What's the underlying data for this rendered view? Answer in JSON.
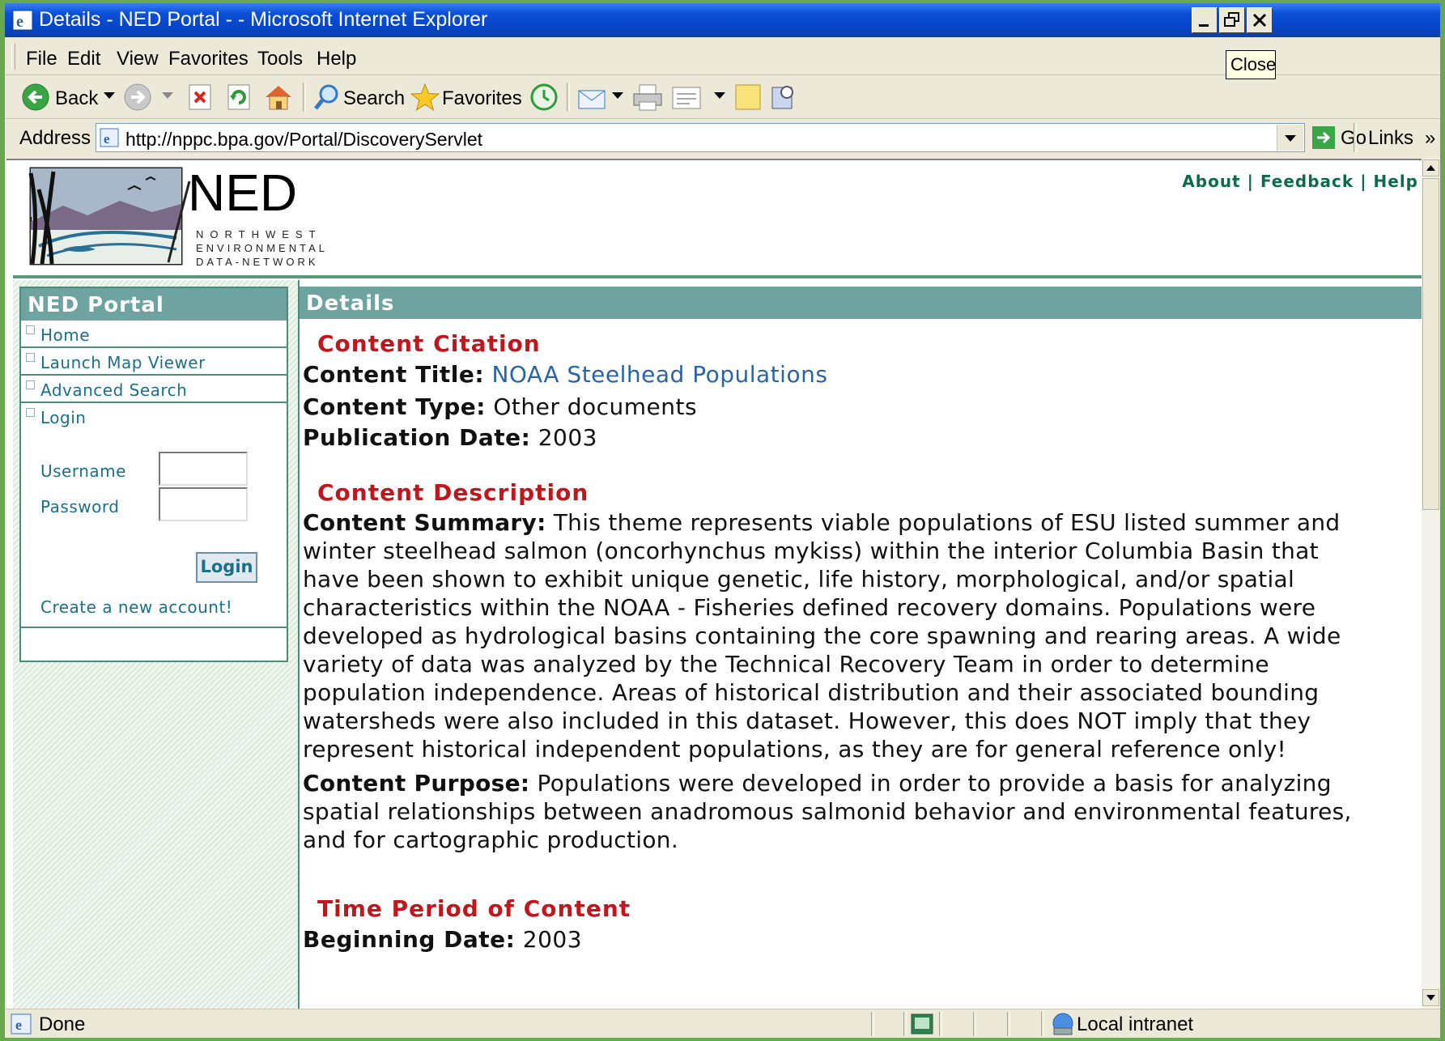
{
  "window": {
    "title": "Details - NED Portal - - Microsoft Internet Explorer",
    "tooltip": "Close"
  },
  "menu": [
    "File",
    "Edit",
    "View",
    "Favorites",
    "Tools",
    "Help"
  ],
  "toolbar": {
    "back": "Back",
    "search": "Search",
    "favorites": "Favorites"
  },
  "address": {
    "label": "Address",
    "url": "http://nppc.bpa.gov/Portal/DiscoveryServlet",
    "go": "Go",
    "links": "Links"
  },
  "logo": {
    "big": "NED",
    "line1": "NORTHWEST",
    "line2": "ENVIRONMENTAL",
    "line3": "DATA-NETWORK"
  },
  "top_links": [
    "About",
    "Feedback",
    "Help"
  ],
  "sidebar": {
    "title": "NED Portal",
    "items": [
      "Home",
      "Launch Map Viewer",
      "Advanced Search",
      "Login"
    ],
    "username_label": "Username",
    "password_label": "Password",
    "login_button": "Login",
    "create_account": "Create a new account!"
  },
  "main": {
    "title": "Details",
    "citation_heading": "Content Citation",
    "content_title_label": "Content Title:",
    "content_title_value": "NOAA Steelhead Populations",
    "content_type_label": "Content Type:",
    "content_type_value": "Other documents",
    "pub_date_label": "Publication Date:",
    "pub_date_value": "2003",
    "description_heading": "Content Description",
    "summary_label": "Content Summary:",
    "summary_lines": [
      " This theme represents viable populations of ESU listed summer and",
      "winter steelhead salmon (oncorhynchus mykiss) within the interior Columbia Basin that",
      "have been shown to exhibit unique genetic, life history, morphological, and/or spatial",
      "characteristics within the NOAA - Fisheries defined recovery domains. Populations were",
      "developed as hydrological basins containing the core spawning and rearing areas. A wide",
      "variety of data was analyzed by the Technical Recovery Team in order to determine",
      "population independence. Areas of historical distribution and their associated bounding",
      "watersheds were also included in this dataset. However, this does NOT imply that they",
      "represent historical independent populations, as they are for general reference only!"
    ],
    "purpose_label": "Content Purpose:",
    "purpose_lines": [
      " Populations were developed in order to provide a basis for analyzing",
      "spatial relationships between anadromous salmonid behavior and environmental features,",
      "and for cartographic production."
    ],
    "time_heading": "Time Period of Content",
    "begin_label": "Beginning Date:",
    "begin_value": "2003"
  },
  "status": {
    "text": "Done",
    "zone": "Local intranet"
  },
  "colors": {
    "section_red": "#c0161c",
    "header_teal": "#6fa3a0",
    "link_blue": "#1b6f8a",
    "top_link_green": "#0b6b4a"
  }
}
